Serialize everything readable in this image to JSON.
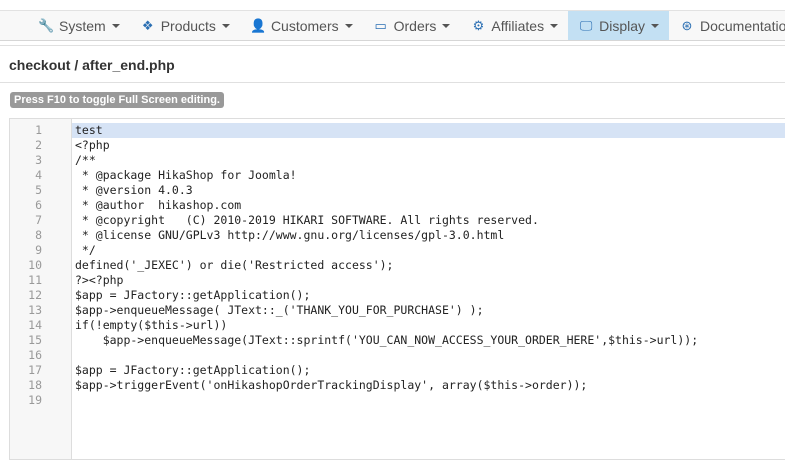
{
  "nav": [
    {
      "label": "System",
      "icon": "wrench-icon",
      "glyph": "🔧"
    },
    {
      "label": "Products",
      "icon": "cubes-icon",
      "glyph": "❖"
    },
    {
      "label": "Customers",
      "icon": "user-icon",
      "glyph": "👤"
    },
    {
      "label": "Orders",
      "icon": "credit-card-icon",
      "glyph": "▭"
    },
    {
      "label": "Affiliates",
      "icon": "users-gear-icon",
      "glyph": "⚙"
    },
    {
      "label": "Display",
      "icon": "monitor-icon",
      "glyph": "🖵"
    },
    {
      "label": "Documentation",
      "icon": "life-ring-icon",
      "glyph": "⊛"
    }
  ],
  "active_nav": "Display",
  "title": "checkout / after_end.php",
  "hint": "Press F10 to toggle Full Screen editing.",
  "code": [
    "test",
    "<?php",
    "/**",
    " * @package HikaShop for Joomla!",
    " * @version 4.0.3",
    " * @author  hikashop.com",
    " * @copyright   (C) 2010-2019 HIKARI SOFTWARE. All rights reserved.",
    " * @license GNU/GPLv3 http://www.gnu.org/licenses/gpl-3.0.html",
    " */",
    "defined('_JEXEC') or die('Restricted access');",
    "?><?php",
    "$app = JFactory::getApplication();",
    "$app->enqueueMessage( JText::_('THANK_YOU_FOR_PURCHASE') );",
    "if(!empty($this->url))",
    "    $app->enqueueMessage(JText::sprintf('YOU_CAN_NOW_ACCESS_YOUR_ORDER_HERE',$this->url));",
    "",
    "$app = JFactory::getApplication();",
    "$app->triggerEvent('onHikashopOrderTrackingDisplay', array($this->order));",
    ""
  ],
  "line_numbers": [
    "1",
    "2",
    "3",
    "4",
    "5",
    "6",
    "7",
    "8",
    "9",
    "10",
    "11",
    "12",
    "13",
    "14",
    "15",
    "16",
    "17",
    "18",
    "19"
  ]
}
